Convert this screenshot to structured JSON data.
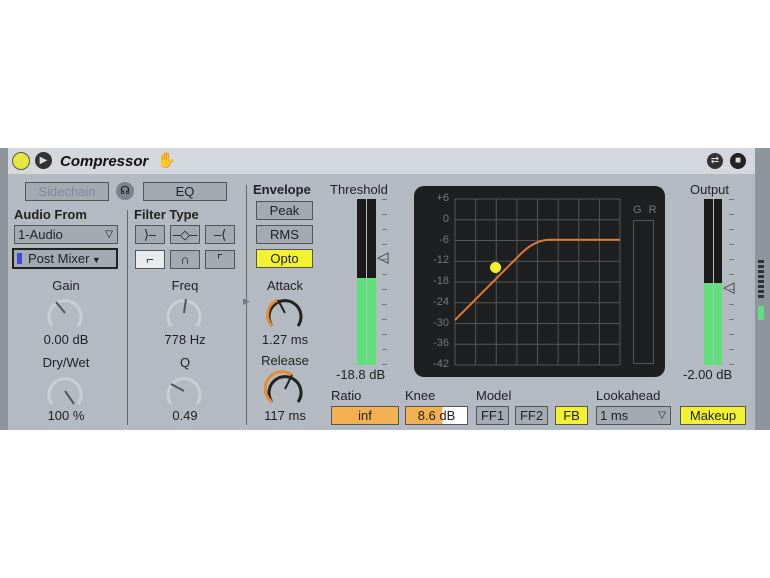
{
  "device": {
    "title": "Compressor"
  },
  "sidechain": {
    "sidechain_label": "Sidechain",
    "eq_label": "EQ",
    "audio_from_label": "Audio From",
    "audio_from_value": "1-Audio",
    "tap_value": "Post Mixer",
    "gain_label": "Gain",
    "gain_value": "0.00 dB",
    "drywet_label": "Dry/Wet",
    "drywet_value": "100 %"
  },
  "filter": {
    "type_label": "Filter Type",
    "freq_label": "Freq",
    "freq_value": "778 Hz",
    "q_label": "Q",
    "q_value": "0.49"
  },
  "envelope": {
    "label": "Envelope",
    "peak": "Peak",
    "rms": "RMS",
    "opto": "Opto",
    "attack_label": "Attack",
    "attack_value": "1.27 ms",
    "release_label": "Release",
    "release_value": "117 ms"
  },
  "threshold": {
    "label": "Threshold",
    "value": "-18.8 dB"
  },
  "graph": {
    "y_labels": [
      "+6",
      "0",
      "-6",
      "-12",
      "-18",
      "-24",
      "-30",
      "-36",
      "-42"
    ],
    "gr_label": "G R"
  },
  "output": {
    "label": "Output",
    "value": "-2.00 dB"
  },
  "bottom": {
    "ratio_label": "Ratio",
    "ratio_value": "inf",
    "knee_label": "Knee",
    "knee_num": "8.6",
    "knee_unit": "dB",
    "model_label": "Model",
    "ff1": "FF1",
    "ff2": "FF2",
    "fb": "FB",
    "lookahead_label": "Lookahead",
    "lookahead_value": "1 ms",
    "makeup": "Makeup"
  },
  "colors": {
    "accent_yellow": "#f2f230",
    "accent_orange": "#f3b050",
    "meter_green": "#5fe07a",
    "curve": "#e07a30"
  }
}
